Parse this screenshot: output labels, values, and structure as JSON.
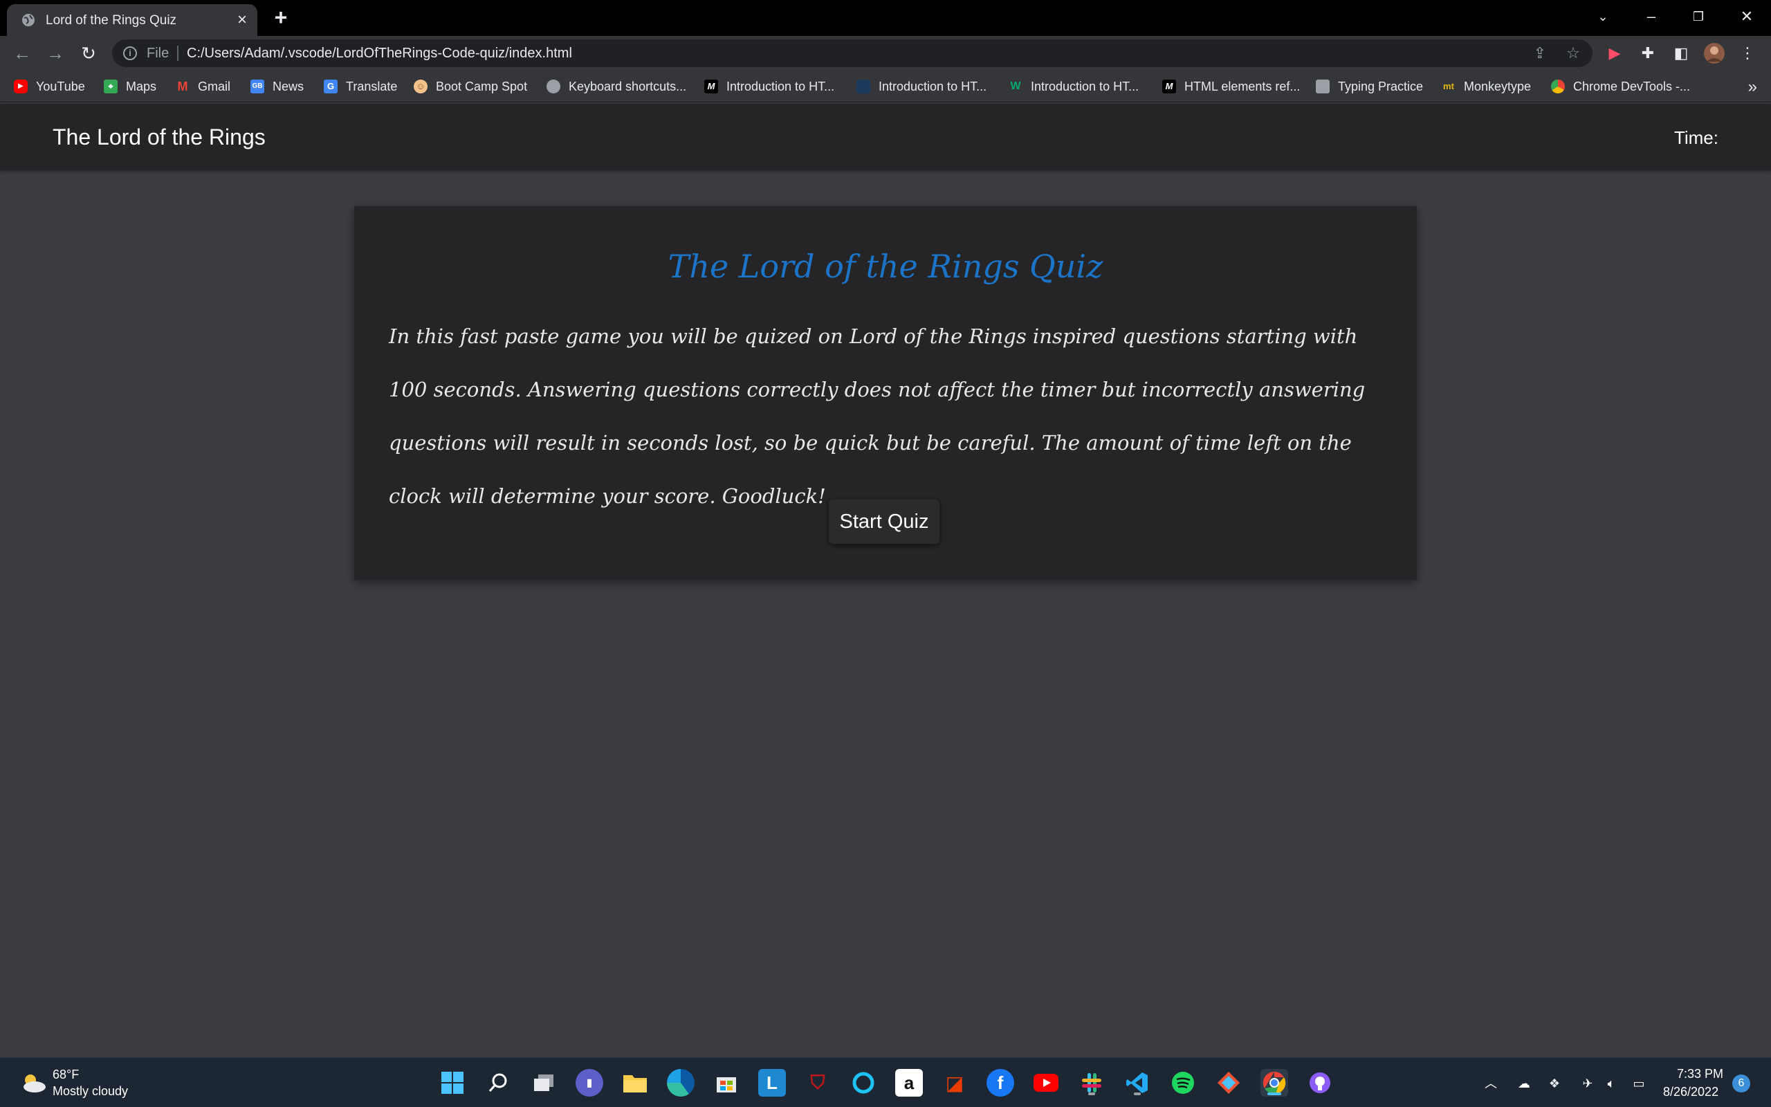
{
  "browser": {
    "tab_title": "Lord of the Rings Quiz",
    "url_scheme": "File",
    "url": "C:/Users/Adam/.vscode/LordOfTheRings-Code-quiz/index.html",
    "bookmarks": [
      {
        "label": "YouTube",
        "icon": "youtube-icon",
        "color": "#ff0000"
      },
      {
        "label": "Maps",
        "icon": "maps-icon",
        "color": "#34a853"
      },
      {
        "label": "Gmail",
        "icon": "gmail-icon",
        "color": "#ea4335"
      },
      {
        "label": "News",
        "icon": "news-icon",
        "color": "#4285f4"
      },
      {
        "label": "Translate",
        "icon": "translate-icon",
        "color": "#4285f4"
      },
      {
        "label": "Boot Camp Spot",
        "icon": "bootcamp-icon",
        "color": "#f4c28a"
      },
      {
        "label": "Keyboard shortcuts...",
        "icon": "globe-icon",
        "color": "#9aa0a6"
      },
      {
        "label": "Introduction to HT...",
        "icon": "medium-icon",
        "color": "#000000"
      },
      {
        "label": "Introduction to HT...",
        "icon": "doc-icon",
        "color": "#1a3a5c"
      },
      {
        "label": "Introduction to HT...",
        "icon": "w3-icon",
        "color": "#04aa6d"
      },
      {
        "label": "HTML elements ref...",
        "icon": "medium-icon",
        "color": "#000000"
      },
      {
        "label": "Typing Practice",
        "icon": "typing-icon",
        "color": "#9aa0a6"
      },
      {
        "label": "Monkeytype",
        "icon": "monkeytype-icon",
        "color": "#e2b714"
      },
      {
        "label": "Chrome DevTools -...",
        "icon": "chrome-icon",
        "color": "#4285f4"
      }
    ]
  },
  "page": {
    "site_title": "The Lord of the Rings",
    "timer_label": "Time:",
    "quiz_title": "The Lord of the Rings Quiz",
    "quiz_description": "In this fast paste game you will be quized on Lord of the Rings inspired questions starting with 100 seconds. Answering questions correctly does not affect the timer but incorrectly answering questions will result in seconds lost, so be quick but be careful. The amount of time left on the clock will determine your score. Goodluck!",
    "start_button": "Start Quiz"
  },
  "taskbar": {
    "weather_temp": "68°F",
    "weather_condition": "Mostly cloudy",
    "time": "7:33 PM",
    "date": "8/26/2022",
    "notification_count": "6"
  },
  "colors": {
    "accent_title": "#1b74c7",
    "page_background": "#3d3c43",
    "card_background": "#252527"
  }
}
